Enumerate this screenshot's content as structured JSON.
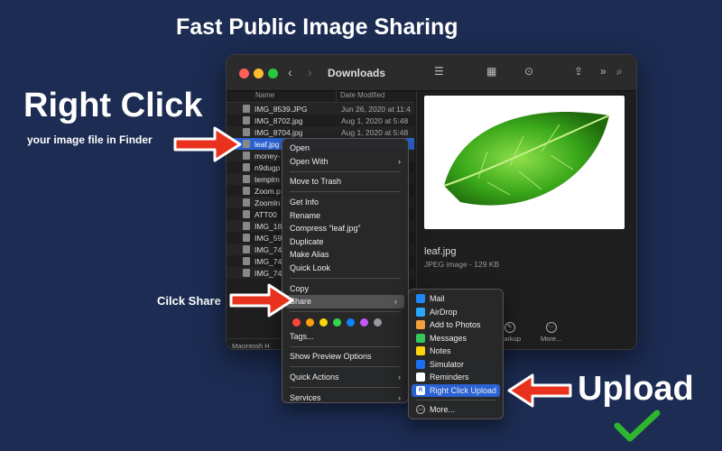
{
  "headline": "Fast Public Image Sharing",
  "callouts": {
    "right_click": "Right Click",
    "right_click_sub": "your image file in Finder",
    "share": "Cilck Share",
    "upload": "Upload"
  },
  "window": {
    "title": "Downloads",
    "columns": {
      "name": "Name",
      "date": "Date Modified"
    },
    "files": [
      {
        "name": "IMG_8539.JPG",
        "date": "Jun 26, 2020 at 11:4"
      },
      {
        "name": "IMG_8702.jpg",
        "date": "Aug 1, 2020 at 5:48"
      },
      {
        "name": "IMG_8704.jpg",
        "date": "Aug 1, 2020 at 5:48"
      },
      {
        "name": "leaf.jpg",
        "date": ""
      },
      {
        "name": "money-",
        "date": ""
      },
      {
        "name": "n9dugp",
        "date": ""
      },
      {
        "name": "templm",
        "date": ""
      },
      {
        "name": "Zoom.p",
        "date": ""
      },
      {
        "name": "Zoomln",
        "date": ""
      },
      {
        "name": "ATT00",
        "date": ""
      },
      {
        "name": "IMG_18",
        "date": ""
      },
      {
        "name": "IMG_59",
        "date": ""
      },
      {
        "name": "IMG_74",
        "date": ""
      },
      {
        "name": "IMG_74",
        "date": ""
      },
      {
        "name": "IMG_74",
        "date": ""
      }
    ],
    "selected_index": 3,
    "path": "Macintosh H",
    "preview": {
      "name": "leaf.jpg",
      "type": "JPEG image - 129 KB",
      "actions": [
        {
          "label": "Markup",
          "icon": "markup-icon"
        },
        {
          "label": "More...",
          "icon": "more-icon"
        }
      ]
    }
  },
  "context_menu": {
    "group1": [
      "Open",
      "Open With"
    ],
    "group2": [
      "Move to Trash"
    ],
    "group3": [
      "Get Info",
      "Rename",
      "Compress “leaf.jpg”",
      "Duplicate",
      "Make Alias",
      "Quick Look"
    ],
    "group4": [
      "Copy",
      "Share"
    ],
    "tags_label": "Tags...",
    "tag_colors": [
      "#ff453a",
      "#ff9f0a",
      "#ffd60a",
      "#32d74b",
      "#0a84ff",
      "#bf5af2",
      "#98989d"
    ],
    "preview_options": "Show Preview Options",
    "quick_actions": "Quick Actions",
    "services": "Services"
  },
  "share_menu": {
    "items": [
      {
        "label": "Mail",
        "color": "#1e88ff"
      },
      {
        "label": "AirDrop",
        "color": "#2aa8ff"
      },
      {
        "label": "Add to Photos",
        "color": "#f2a23c"
      },
      {
        "label": "Messages",
        "color": "#34c759"
      },
      {
        "label": "Notes",
        "color": "#ffd60a"
      },
      {
        "label": "Simulator",
        "color": "#1b6ff0"
      },
      {
        "label": "Reminders",
        "color": "#ffffff"
      },
      {
        "label": "Right Click Upload",
        "color": "#2a62d4",
        "badge": "R"
      }
    ],
    "more": "More..."
  },
  "colors": {
    "background": "#1c2c52",
    "arrow": "#e8321e",
    "check": "#2fb52f",
    "selection": "#2a62d4"
  }
}
